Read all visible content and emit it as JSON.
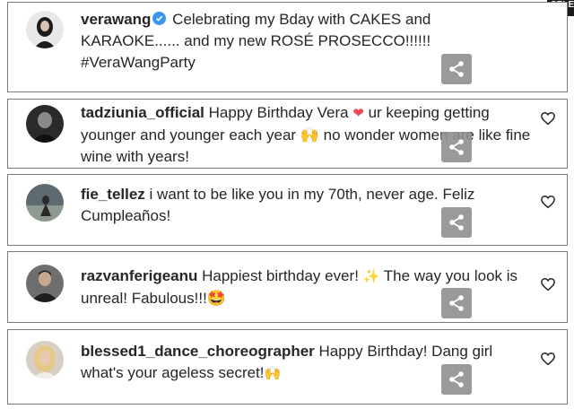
{
  "corner_badge": "SELE",
  "comments": [
    {
      "username": "verawang",
      "verified": true,
      "text_before": " Celebrating my Bday with CAKES and KARAOKE...... and my new ROSÉ PROSECCO!!!!!! #VeraWangParty",
      "emoji": "",
      "text_after": "",
      "has_like": false
    },
    {
      "username": "tadziunia_official",
      "verified": false,
      "text_before": " Happy Birthday Vera ",
      "emoji": "❤",
      "text_after": " ur keeping getting younger and younger each year 🙌 no wonder women are like fine wine with years!",
      "has_like": true
    },
    {
      "username": "fie_tellez",
      "verified": false,
      "text_before": " i want to be like you in my 70th, never age. Feliz Cumpleaños!",
      "emoji": "",
      "text_after": "",
      "has_like": true
    },
    {
      "username": "razvanferigeanu",
      "verified": false,
      "text_before": " Happiest birthday ever! ",
      "emoji": "✨",
      "text_after": " The way you look is unreal! Fabulous!!!🤩",
      "has_like": true
    },
    {
      "username": "blessed1_dance_choreographer",
      "verified": false,
      "text_before": " Happy Birthday! Dang girl what's your ageless secret!",
      "emoji": "🙌",
      "text_after": "",
      "has_like": true
    }
  ],
  "colors": {
    "border": "#7a7a7a",
    "verified_blue": "#3897f0",
    "heart_red": "#ed4956",
    "share_gray": "#909090",
    "text": "#262626"
  },
  "icons": {
    "verified": "verified-badge-icon",
    "like": "heart-outline-icon",
    "share": "share-icon"
  }
}
